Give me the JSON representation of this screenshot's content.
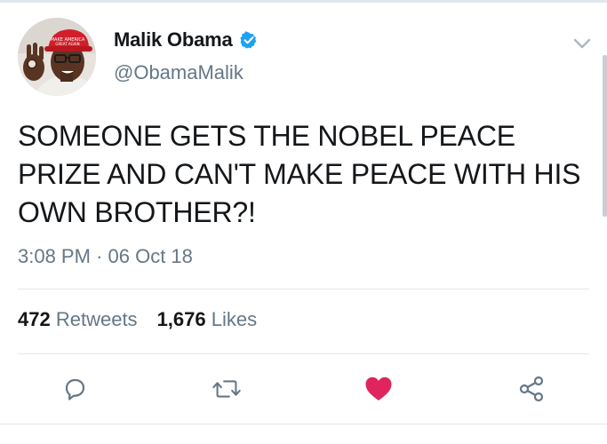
{
  "tweet": {
    "author": {
      "display_name": "Malik Obama",
      "handle": "@ObamaMalik",
      "verified": true,
      "avatar_icon": "profile-photo"
    },
    "text": "SOMEONE GETS THE NOBEL PEACE PRIZE AND CAN'T MAKE PEACE WITH HIS OWN BROTHER?!",
    "time": "3:08 PM",
    "separator": "·",
    "date": "06 Oct 18"
  },
  "stats": {
    "retweets_count": "472",
    "retweets_label": "Retweets",
    "likes_count": "1,676",
    "likes_label": "Likes"
  },
  "actions": {
    "reply_icon": "reply-icon",
    "retweet_icon": "retweet-icon",
    "like_icon": "heart-icon",
    "share_icon": "share-icon",
    "liked": true
  },
  "colors": {
    "text": "#14171a",
    "secondary": "#657786",
    "accent": "#1da1f2",
    "like": "#e0245e",
    "divider": "#e1e8ed"
  }
}
